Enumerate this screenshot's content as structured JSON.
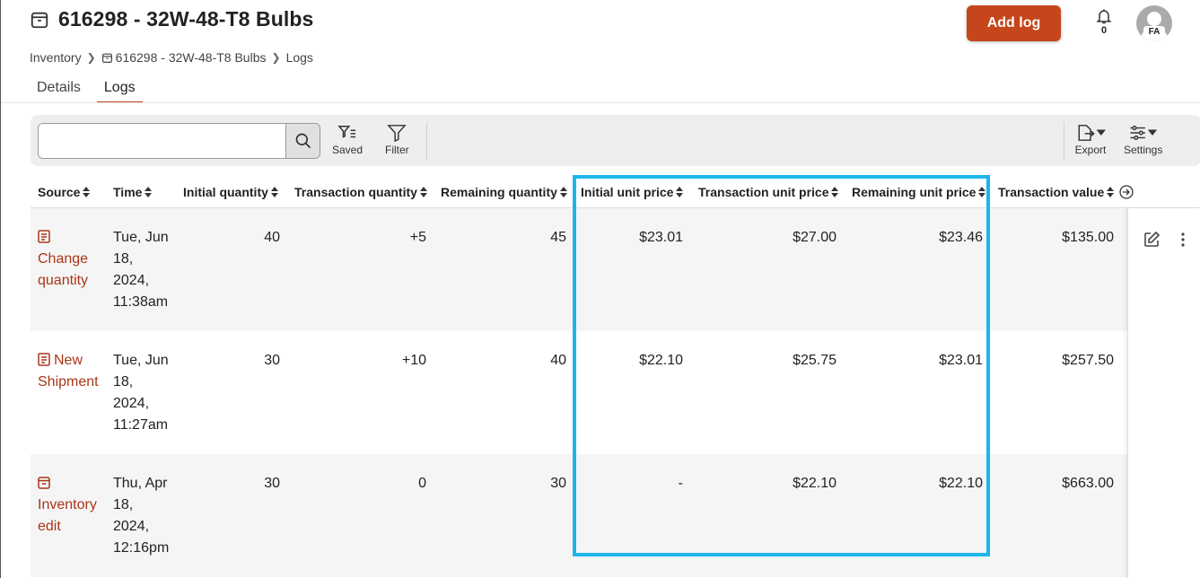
{
  "header": {
    "title": "616298 - 32W-48-T8 Bulbs",
    "add_log_label": "Add log",
    "notifications_count": "0",
    "avatar_initials": "FA"
  },
  "breadcrumb": {
    "root": "Inventory",
    "item": "616298 - 32W-48-T8 Bulbs",
    "current": "Logs"
  },
  "tabs": [
    "Details",
    "Logs"
  ],
  "toolbar": {
    "search_placeholder": "",
    "saved_label": "Saved",
    "filter_label": "Filter",
    "export_label": "Export",
    "settings_label": "Settings"
  },
  "table": {
    "columns": [
      "Source",
      "Time",
      "Initial quantity",
      "Transaction quantity",
      "Remaining quantity",
      "Initial unit price",
      "Transaction unit price",
      "Remaining unit price",
      "Transaction value"
    ],
    "rows": [
      {
        "source_line1": "Change",
        "source_line2": "quantity",
        "source_icon": "document-icon",
        "time": [
          "Tue, Jun",
          "18,",
          "2024,",
          "11:38am"
        ],
        "initial_quantity": "40",
        "transaction_quantity": "+5",
        "remaining_quantity": "45",
        "initial_unit_price": "$23.01",
        "transaction_unit_price": "$27.00",
        "remaining_unit_price": "$23.46",
        "transaction_value": "$135.00"
      },
      {
        "source_line1": "New",
        "source_line2": "Shipment",
        "source_icon": "document-icon",
        "time": [
          "Tue, Jun",
          "18,",
          "2024,",
          "11:27am"
        ],
        "initial_quantity": "30",
        "transaction_quantity": "+10",
        "remaining_quantity": "40",
        "initial_unit_price": "$22.10",
        "transaction_unit_price": "$25.75",
        "remaining_unit_price": "$23.01",
        "transaction_value": "$257.50"
      },
      {
        "source_line1": "Inventory",
        "source_line2": "edit",
        "source_icon": "box-icon",
        "time": [
          "Thu, Apr",
          "18,",
          "2024,",
          "12:16pm"
        ],
        "initial_quantity": "30",
        "transaction_quantity": "0",
        "remaining_quantity": "30",
        "initial_unit_price": "-",
        "transaction_unit_price": "$22.10",
        "remaining_unit_price": "$22.10",
        "transaction_value": "$663.00"
      }
    ]
  },
  "colors": {
    "accent": "#c5461a",
    "source_link": "#a8361a",
    "highlight": "#1eb5ea"
  }
}
